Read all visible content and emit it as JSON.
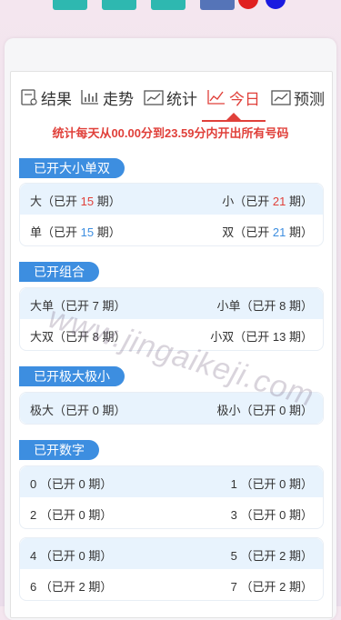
{
  "top_buttons": {
    "colors": [
      "#2eb8b0",
      "#2eb8b0",
      "#2eb8b0",
      "#5574b8",
      "#e02020",
      "#1a1ae0"
    ]
  },
  "tabs": [
    {
      "label": "结果",
      "icon": "result-icon",
      "active": false
    },
    {
      "label": "走势",
      "icon": "trend-icon",
      "active": false
    },
    {
      "label": "统计",
      "icon": "stats-icon",
      "active": false
    },
    {
      "label": "今日",
      "icon": "today-icon",
      "active": true
    },
    {
      "label": "预测",
      "icon": "forecast-icon",
      "active": false
    }
  ],
  "notice": "统计每天从00.00分到23.59分内开出所有号码",
  "sections": {
    "size_parity": {
      "title": "已开大小单双",
      "rows": [
        {
          "left_name": "大",
          "left_count": "15",
          "right_name": "小",
          "right_count": "21"
        },
        {
          "left_name": "单",
          "left_count": "15",
          "right_name": "双",
          "right_count": "21"
        }
      ]
    },
    "combo": {
      "title": "已开组合",
      "rows": [
        {
          "left_name": "大单",
          "left_count": "7",
          "right_name": "小单",
          "right_count": "8"
        },
        {
          "left_name": "大双",
          "left_count": "8",
          "right_name": "小双",
          "right_count": "13"
        }
      ]
    },
    "extreme": {
      "title": "已开极大极小",
      "rows": [
        {
          "left_name": "极大",
          "left_count": "0",
          "right_name": "极小",
          "right_count": "0"
        }
      ]
    },
    "digits": {
      "title": "已开数字",
      "rows": [
        {
          "left_name": "0",
          "left_count": "0",
          "right_name": "1",
          "right_count": "0"
        },
        {
          "left_name": "2",
          "left_count": "0",
          "right_name": "3",
          "right_count": "0"
        },
        {
          "left_name": "4",
          "left_count": "0",
          "right_name": "5",
          "right_count": "2"
        },
        {
          "left_name": "6",
          "left_count": "2",
          "right_name": "7",
          "right_count": "2"
        }
      ]
    }
  },
  "labels": {
    "open_prefix": "（已开",
    "period_suffix": "期）"
  },
  "watermark": "www.jingaikeji.com",
  "colors": {
    "accent_red": "#e0403a",
    "accent_blue": "#3d8ee0",
    "row_shade": "#e8f3fd"
  }
}
